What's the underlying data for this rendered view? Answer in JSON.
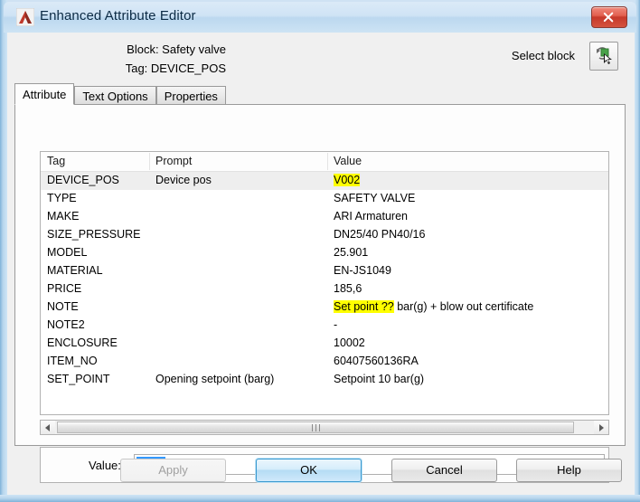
{
  "window": {
    "title": "Enhanced Attribute Editor",
    "logo_icon": "autocad-logo-icon",
    "close_icon": "close-icon"
  },
  "header": {
    "block_line": "Block: Safety valve",
    "tag_line": "Tag: DEVICE_POS",
    "select_block_label": "Select block",
    "select_block_icon": "select-block-icon"
  },
  "tabs": [
    {
      "label": "Attribute",
      "active": true
    },
    {
      "label": "Text Options",
      "active": false
    },
    {
      "label": "Properties",
      "active": false
    }
  ],
  "grid": {
    "columns": [
      "Tag",
      "Prompt",
      "Value"
    ],
    "rows": [
      {
        "tag": "DEVICE_POS",
        "prompt": "Device pos",
        "value": "V002",
        "selected": true,
        "value_highlight": "V002"
      },
      {
        "tag": "TYPE",
        "prompt": "",
        "value": "SAFETY VALVE",
        "selected": false,
        "value_highlight": ""
      },
      {
        "tag": "MAKE",
        "prompt": "",
        "value": "ARI Armaturen",
        "selected": false,
        "value_highlight": ""
      },
      {
        "tag": "SIZE_PRESSURE",
        "prompt": "",
        "value": "DN25/40 PN40/16",
        "selected": false,
        "value_highlight": ""
      },
      {
        "tag": "MODEL",
        "prompt": "",
        "value": "25.901",
        "selected": false,
        "value_highlight": ""
      },
      {
        "tag": "MATERIAL",
        "prompt": "",
        "value": "EN-JS1049",
        "selected": false,
        "value_highlight": ""
      },
      {
        "tag": "PRICE",
        "prompt": "",
        "value": "185,6",
        "selected": false,
        "value_highlight": ""
      },
      {
        "tag": "NOTE",
        "prompt": "",
        "value": "Set point ?? bar(g) + blow out certificate",
        "selected": false,
        "value_highlight": "Set point ??"
      },
      {
        "tag": "NOTE2",
        "prompt": "",
        "value": "-",
        "selected": false,
        "value_highlight": ""
      },
      {
        "tag": "ENCLOSURE",
        "prompt": "",
        "value": "10002",
        "selected": false,
        "value_highlight": ""
      },
      {
        "tag": "ITEM_NO",
        "prompt": "",
        "value": "60407560136RA",
        "selected": false,
        "value_highlight": ""
      },
      {
        "tag": "SET_POINT",
        "prompt": "Opening setpoint (barg)",
        "value": "Setpoint 10 bar(g)",
        "selected": false,
        "value_highlight": ""
      }
    ]
  },
  "scrollbar": {
    "left_arrow_icon": "arrow-left-icon",
    "right_arrow_icon": "arrow-right-icon"
  },
  "value_field": {
    "label": "Value:",
    "value": "V002",
    "selected_text": "V002"
  },
  "buttons": [
    {
      "id": "apply",
      "label": "Apply",
      "state": "disabled"
    },
    {
      "id": "ok",
      "label": "OK",
      "state": "default"
    },
    {
      "id": "cancel",
      "label": "Cancel",
      "state": "normal"
    },
    {
      "id": "help",
      "label": "Help",
      "state": "normal"
    }
  ],
  "colors": {
    "highlight_yellow": "#ffff00",
    "selection_blue": "#3399ff",
    "titlebar_blue": "#cfe3f5",
    "close_red": "#c6392a",
    "row_selected_gray": "#eeeeee"
  }
}
